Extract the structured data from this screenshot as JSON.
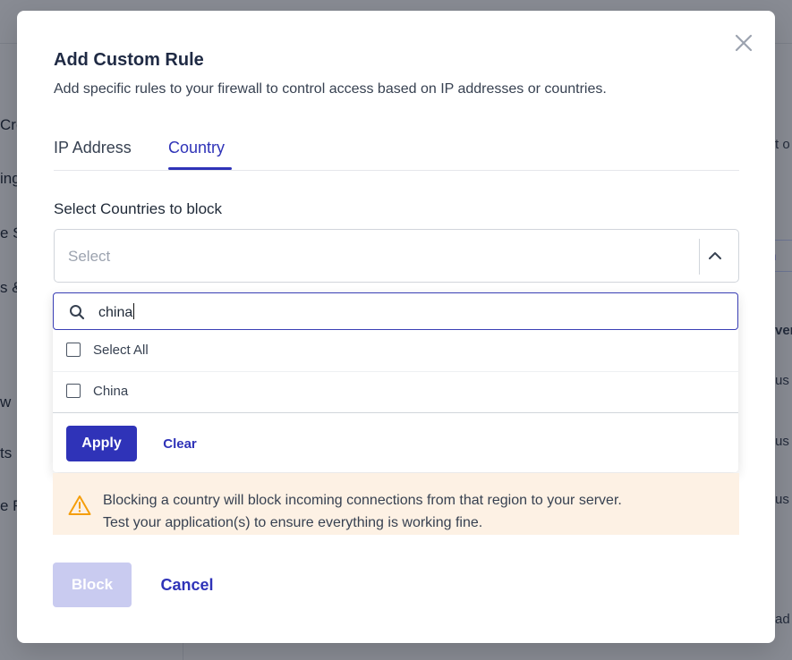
{
  "background": {
    "sidebar_fragments": [
      "Cre",
      "ing",
      "e S",
      "s &",
      "w",
      "ts",
      "e R"
    ],
    "right_fragments": [
      "t o",
      "us",
      "us",
      "us",
      "ad"
    ],
    "right_button_label": "n",
    "right_header": "ver"
  },
  "modal": {
    "title": "Add Custom Rule",
    "subtitle": "Add specific rules to your firewall to control access based on IP addresses or countries.",
    "tabs": [
      {
        "label": "IP Address",
        "active": false
      },
      {
        "label": "Country",
        "active": true
      }
    ],
    "field_label": "Select Countries to block",
    "select": {
      "placeholder": "Select"
    },
    "dropdown": {
      "search_value": "china",
      "options": [
        {
          "label": "Select All",
          "checked": false
        },
        {
          "label": "China",
          "checked": false
        }
      ],
      "apply_label": "Apply",
      "clear_label": "Clear"
    },
    "warning": {
      "line1": "Blocking a country will block incoming connections from that region to your server.",
      "line2": "Test your application(s) to ensure everything is working fine."
    },
    "block_label": "Block",
    "cancel_label": "Cancel"
  },
  "colors": {
    "primary": "#2f33b8",
    "primary_disabled": "#c9cbf0",
    "warning_bg": "#fdf1e4",
    "warning_icon": "#f59e0b",
    "overlay": "rgba(17,24,39,0.5)"
  },
  "icons": {
    "close": "close-icon",
    "chevron": "chevron-up-icon",
    "search": "search-icon",
    "warning": "warning-icon"
  }
}
